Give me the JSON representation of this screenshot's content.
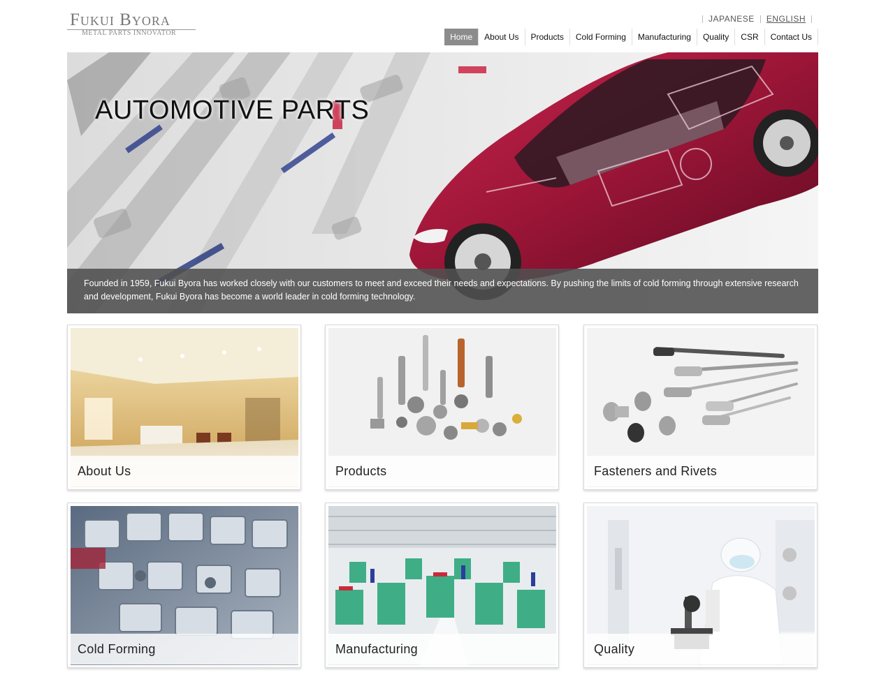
{
  "logo": {
    "main": "Fukui Byora",
    "sub": "METAL PARTS INNOVATOR"
  },
  "lang": {
    "japanese": "JAPANESE",
    "english": "ENGLISH"
  },
  "nav": {
    "home": "Home",
    "about": "About Us",
    "products": "Products",
    "cold_forming": "Cold Forming",
    "manufacturing": "Manufacturing",
    "quality": "Quality",
    "csr": "CSR",
    "contact": "Contact Us"
  },
  "hero": {
    "title": "AUTOMOTIVE PARTS",
    "caption": "Founded in 1959, Fukui Byora has worked closely with our customers to meet and exceed their needs and expectations. By pushing the limits of cold forming through extensive research and development, Fukui Byora has become a world leader in cold forming technology."
  },
  "cards": [
    {
      "label": "About Us"
    },
    {
      "label": "Products"
    },
    {
      "label": "Fasteners and Rivets"
    },
    {
      "label": "Cold Forming"
    },
    {
      "label": "Manufacturing"
    },
    {
      "label": "Quality"
    }
  ],
  "colors": {
    "nav_active_bg": "#8c8c8c",
    "caption_bg": "#505050",
    "car_red": "#a01a3a"
  }
}
